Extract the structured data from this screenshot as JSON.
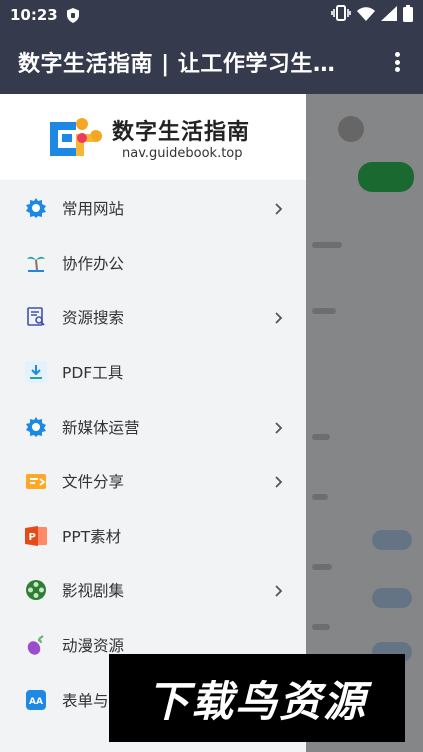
{
  "status_bar": {
    "time": "10:23"
  },
  "app_bar": {
    "title": "数字生活指南 | 让工作学习生…"
  },
  "drawer": {
    "logo_title": "数字生活指南",
    "logo_subtitle": "nav.guidebook.top",
    "items": [
      {
        "label": "常用网站",
        "icon": "gear-icon",
        "chevron": true
      },
      {
        "label": "协作办公",
        "icon": "palm-tree-icon",
        "chevron": false
      },
      {
        "label": "资源搜索",
        "icon": "document-search-icon",
        "chevron": true
      },
      {
        "label": "PDF工具",
        "icon": "pdf-tool-icon",
        "chevron": false
      },
      {
        "label": "新媒体运营",
        "icon": "gear-icon",
        "chevron": true
      },
      {
        "label": "文件分享",
        "icon": "folder-share-icon",
        "chevron": true
      },
      {
        "label": "PPT素材",
        "icon": "powerpoint-icon",
        "chevron": false
      },
      {
        "label": "影视剧集",
        "icon": "film-reel-icon",
        "chevron": true
      },
      {
        "label": "动漫资源",
        "icon": "eggplant-icon",
        "chevron": false
      },
      {
        "label": "表单与",
        "icon": "form-aa-icon",
        "chevron": false
      }
    ]
  },
  "watermark": {
    "text": "下载鸟资源"
  },
  "colors": {
    "app_bar": "#353a4d",
    "accent_blue": "#1e88e5",
    "drawer_bg": "#f2f3f5"
  }
}
